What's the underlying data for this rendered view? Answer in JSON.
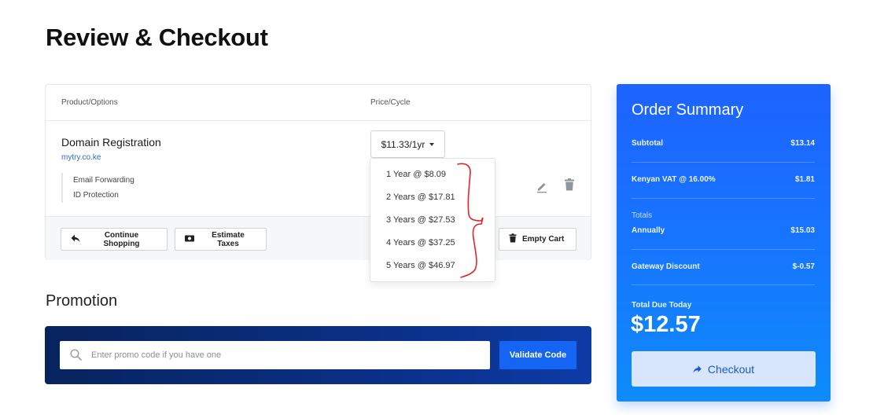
{
  "page": {
    "title": "Review & Checkout"
  },
  "cart": {
    "col_product": "Product/Options",
    "col_price": "Price/Cycle",
    "item": {
      "name": "Domain Registration",
      "domain": "mytry.co.ke",
      "addons": [
        "Email Forwarding",
        "ID Protection"
      ],
      "price_selected": "$11.33/1yr"
    },
    "buttons": {
      "continue": "Continue Shopping",
      "estimate": "Estimate Taxes",
      "empty": "Empty Cart"
    },
    "icons": {
      "edit": "pencil-icon",
      "delete": "trash-icon",
      "continue": "arrow-back-icon",
      "estimate": "money-icon",
      "empty": "trash-icon"
    }
  },
  "dropdown": {
    "options": [
      "1 Year @ $8.09",
      "2 Years @ $17.81",
      "3 Years @ $27.53",
      "4 Years @ $37.25",
      "5 Years @ $46.97"
    ]
  },
  "promotion": {
    "title": "Promotion",
    "placeholder": "Enter promo code if you have one",
    "validate": "Validate Code",
    "icon": "search-icon"
  },
  "summary": {
    "title": "Order Summary",
    "subtotal_label": "Subtotal",
    "subtotal_value": "$13.14",
    "vat_label": "Kenyan VAT @ 16.00%",
    "vat_value": "$1.81",
    "totals_label": "Totals",
    "annually_label": "Annually",
    "annually_value": "$15.03",
    "discount_label": "Gateway Discount",
    "discount_value": "$-0.57",
    "due_label": "Total Due Today",
    "due_value": "$12.57",
    "checkout": "Checkout",
    "checkout_icon": "arrow-forward-icon"
  },
  "colors": {
    "accent": "#1565f5",
    "link": "#2b6bd9",
    "annotation": "#e0252b",
    "promo_bg": "#0a2f86"
  }
}
